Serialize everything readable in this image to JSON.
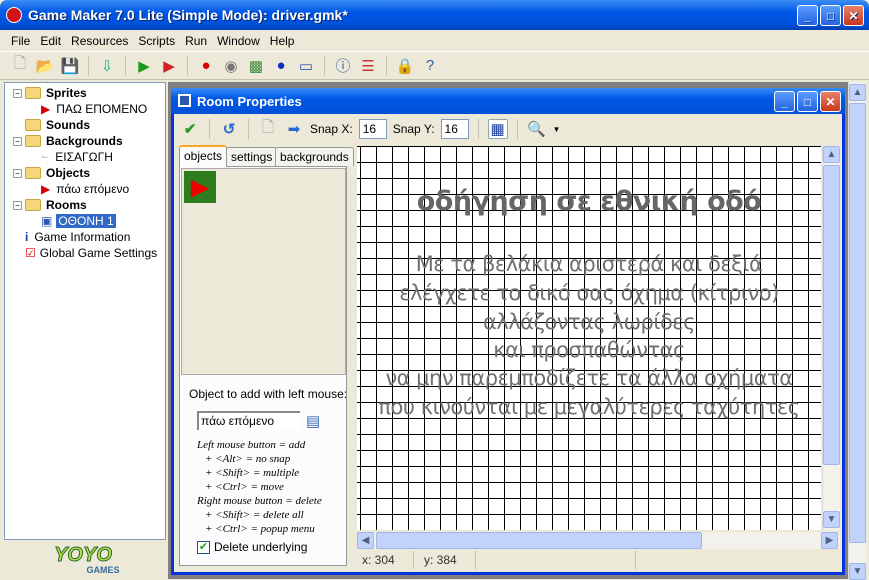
{
  "window": {
    "title": "Game Maker 7.0 Lite (Simple Mode): driver.gmk*"
  },
  "menu": [
    "File",
    "Edit",
    "Resources",
    "Scripts",
    "Run",
    "Window",
    "Help"
  ],
  "toolbar_icons": [
    "new-file-icon",
    "open-icon",
    "save-icon",
    "publish-icon",
    "run-icon",
    "run-debug-icon",
    "sprite-icon",
    "sound-icon",
    "background-icon",
    "object-icon",
    "room-icon",
    "game-info-icon",
    "settings-icon",
    "advanced-mode-icon",
    "help-icon"
  ],
  "tree": {
    "sprites": "Sprites",
    "sprite_item": "ΠΑΩ ΕΠΟΜΕΝΟ",
    "sounds": "Sounds",
    "backgrounds": "Backgrounds",
    "background_item": "ΕΙΣΑΓΩΓΗ",
    "objects": "Objects",
    "object_item": "πάω επόμενο",
    "rooms": "Rooms",
    "room_item": "ΟΘΟΝΗ 1",
    "game_info": "Game Information",
    "global_settings": "Global Game Settings"
  },
  "logo": {
    "text": "YOYO",
    "sub": "GAMES"
  },
  "room": {
    "title": "Room Properties",
    "snap_x_label": "Snap X:",
    "snap_x": "16",
    "snap_y_label": "Snap Y:",
    "snap_y": "16",
    "tabs": [
      "objects",
      "settings",
      "backgrounds"
    ],
    "object_label": "Object to add with left mouse:",
    "object_value": "πάω επόμενο",
    "help": [
      "Left mouse button = add",
      "+ <Alt> = no snap",
      "+ <Shift> = multiple",
      "+ <Ctrl> = move",
      "Right mouse button = delete",
      "+ <Shift> = delete all",
      "+ <Ctrl> = popup menu"
    ],
    "delete_underlying": "Delete underlying",
    "delete_underlying_checked": true,
    "canvas_title": "οδήγηση σε εθνική οδό",
    "canvas_lines": [
      "Με τα βελάκια αριστερά και δεξιά",
      "ελέγχετε το δικό σας όχημα (κίτρινο)",
      "αλλάζοντας λωρίδες",
      "και προσπαθώντας",
      "να μην παρεμποδίζετε τα άλλα οχήματα",
      "που κινούνται με μεγαλύτερες ταχύτητες"
    ],
    "status_x": "x: 304",
    "status_y": "y: 384"
  },
  "colors": {
    "accent": "#0058e6",
    "sprite_red": "#cc0000",
    "object_green": "#2e7d1e"
  }
}
